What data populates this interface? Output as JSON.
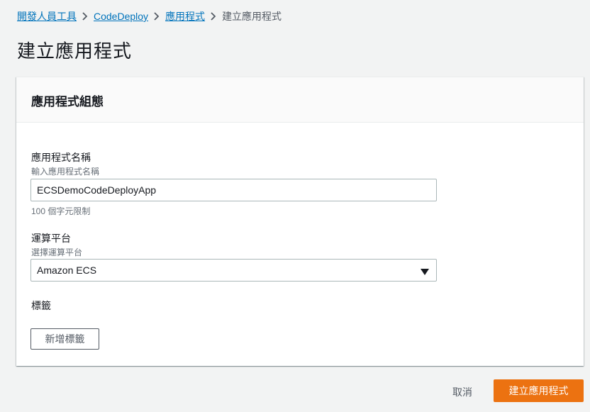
{
  "breadcrumb": {
    "items": [
      "開發人員工具",
      "CodeDeploy",
      "應用程式"
    ],
    "current": "建立應用程式"
  },
  "page": {
    "title": "建立應用程式"
  },
  "panel": {
    "title": "應用程式組態",
    "app_name": {
      "label": "應用程式名稱",
      "description": "輸入應用程式名稱",
      "value": "ECSDemoCodeDeployApp",
      "constraint": "100 個字元限制"
    },
    "platform": {
      "label": "運算平台",
      "description": "選擇運算平台",
      "selected": "Amazon ECS"
    },
    "tags": {
      "label": "標籤",
      "add_button": "新增標籤"
    }
  },
  "footer": {
    "cancel_label": "取消",
    "create_label": "建立應用程式"
  },
  "colors": {
    "link": "#0073bb",
    "primary": "#ec7211",
    "background": "#f2f3f3"
  },
  "icons": {
    "breadcrumb_separator": "chevron-right-icon",
    "select_caret": "caret-down-icon"
  }
}
